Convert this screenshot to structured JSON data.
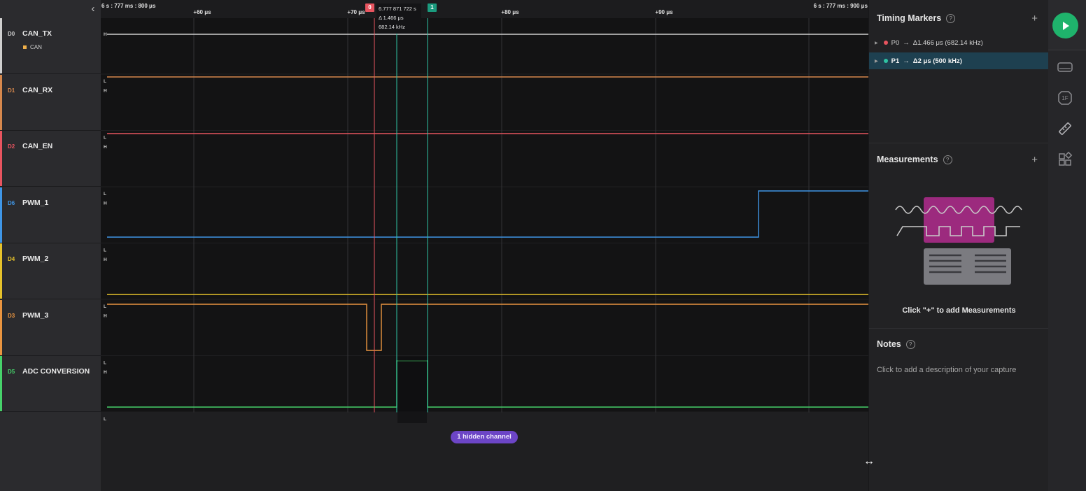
{
  "channels": [
    {
      "num": "D0",
      "name": "CAN_TX",
      "color": "#cfcfcf",
      "analyzer": "CAN"
    },
    {
      "num": "D1",
      "name": "CAN_RX",
      "color": "#d6884d"
    },
    {
      "num": "D2",
      "name": "CAN_EN",
      "color": "#e8545f"
    },
    {
      "num": "D6",
      "name": "PWM_1",
      "color": "#3f96e6"
    },
    {
      "num": "D4",
      "name": "PWM_2",
      "color": "#e6c22b"
    },
    {
      "num": "D3",
      "name": "PWM_3",
      "color": "#ea9540"
    },
    {
      "num": "D5",
      "name": "ADC CONVERSION",
      "color": "#46d26a"
    }
  ],
  "level_labels": {
    "high": "H",
    "low": "L"
  },
  "ruler": {
    "left_label": "6 s : 777 ms : 800 μs",
    "right_label": "6 s : 777 ms : 900 μs",
    "ticks": [
      "+60 μs",
      "+70 μs",
      "+80 μs",
      "+90 μs"
    ]
  },
  "markers": {
    "flag0": "0",
    "flag1": "1",
    "tooltip_time": "6.777 871 722 s",
    "tooltip_delta": "Δ 1.466 μs",
    "tooltip_freq": "682.14 kHz"
  },
  "hidden_channels": "1 hidden channel",
  "timing_markers": {
    "title": "Timing Markers",
    "items": [
      {
        "name": "P0",
        "value": "Δ1.466 μs (682.14 kHz)",
        "color": "#e8545f"
      },
      {
        "name": "P1",
        "value": "Δ2 μs (500 kHz)",
        "color": "#2fc3a3"
      }
    ]
  },
  "measurements": {
    "title": "Measurements",
    "hint": "Click \"+\" to add Measurements"
  },
  "notes": {
    "title": "Notes",
    "placeholder": "Click to add a description of your capture"
  },
  "icons": {
    "collapse": "chevron-left-icon",
    "run": "play-icon",
    "add": "plus-icon",
    "help": "help-icon",
    "resize": "resize-horizontal-icon"
  },
  "help_glyph": "?",
  "add_glyph": "+",
  "colors": {
    "run_button": "#1fb36c",
    "hidden_pill": "#6c45c6",
    "selected_row": "#1e4050",
    "p0_marker": "#e8545f",
    "p1_marker": "#2fc3a3"
  }
}
